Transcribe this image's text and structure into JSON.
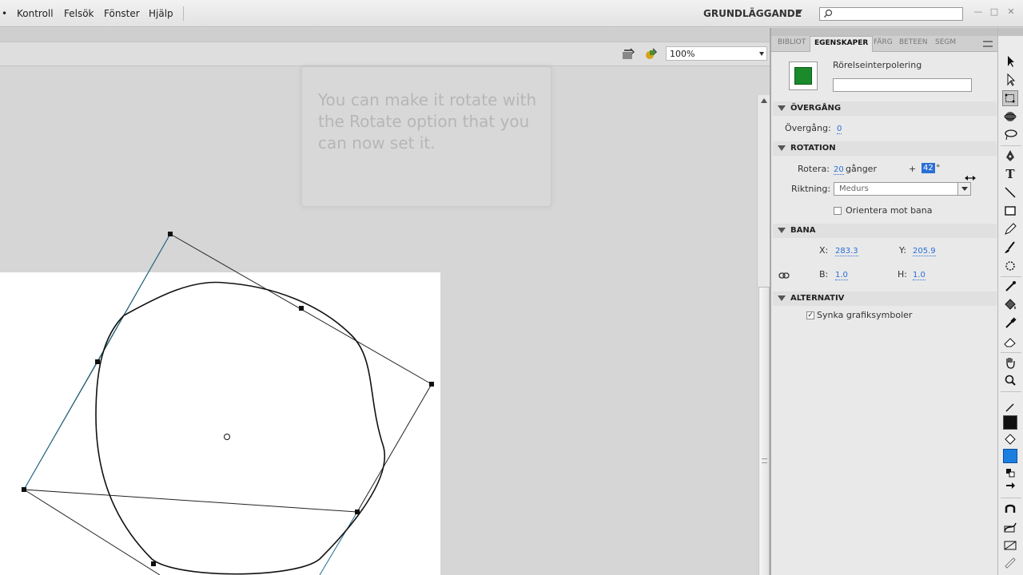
{
  "menubar": {
    "items": [
      "Kontroll",
      "Felsök",
      "Fönster",
      "Hjälp"
    ],
    "workspace": "GRUNDLÄGGANDE"
  },
  "stage": {
    "zoom": "100%"
  },
  "tooltip": {
    "text": "You can make it rotate with the Rotate option that you can now set it."
  },
  "properties": {
    "tabs": [
      "BIBLIOT",
      "EGENSKAPER",
      "FÄRG",
      "BETEEN",
      "SEGM"
    ],
    "instance_type": "Rörelseinterpolering",
    "sections": {
      "overgang": {
        "title": "ÖVERGÅNG",
        "label": "Övergång:",
        "value": "0"
      },
      "rotation": {
        "title": "ROTATION",
        "rotate_label": "Rotera:",
        "rotate_count": "20",
        "rotate_unit": "gånger",
        "plus": "+",
        "degrees": "42",
        "degree_sign": "°",
        "direction_label": "Riktning:",
        "direction_value": "Medurs",
        "orient_label": "Orientera mot bana"
      },
      "bana": {
        "title": "BANA",
        "x_label": "X:",
        "x_value": "283.3",
        "y_label": "Y:",
        "y_value": "205.9",
        "w_label": "B:",
        "w_value": "1.0",
        "h_label": "H:",
        "h_value": "1.0"
      },
      "alternativ": {
        "title": "ALTERNATIV",
        "sync_label": "Synka grafiksymboler",
        "sync_checked": "✓"
      }
    }
  },
  "tools": {
    "text_tool": "T"
  },
  "window": {
    "minimize": "—",
    "maximize": "□",
    "close": "✕"
  }
}
